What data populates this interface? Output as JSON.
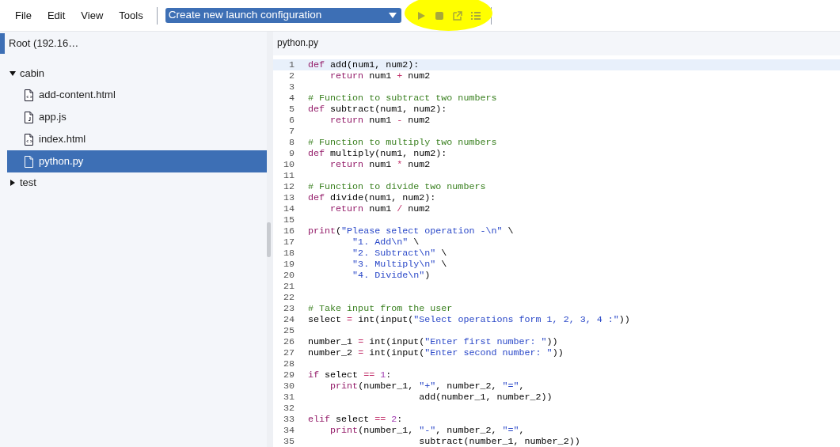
{
  "menu": [
    {
      "label": "File"
    },
    {
      "label": "Edit"
    },
    {
      "label": "View"
    },
    {
      "label": "Tools"
    }
  ],
  "launch_dropdown": {
    "value": "Create new launch configuration"
  },
  "toolbar": {
    "highlighted": true,
    "buttons": [
      {
        "kind": "run",
        "disabled": true
      },
      {
        "kind": "stop",
        "disabled": true
      },
      {
        "kind": "open",
        "disabled": true
      },
      {
        "kind": "list",
        "disabled": true
      }
    ]
  },
  "sidebar": {
    "root": "Root (192.16…",
    "tree": [
      {
        "label": "cabin",
        "expanded": true,
        "selected": false,
        "children": [
          {
            "label": "add-content.html",
            "kind": "html",
            "selected": false
          },
          {
            "label": "app.js",
            "kind": "js",
            "selected": false
          },
          {
            "label": "index.html",
            "kind": "html",
            "selected": false
          },
          {
            "label": "python.py",
            "kind": "file",
            "selected": true
          }
        ]
      },
      {
        "label": "test",
        "expanded": false,
        "selected": false
      }
    ]
  },
  "editor": {
    "tab": "python.py",
    "lines": [
      {
        "number": "1",
        "highlighted": true,
        "tokens": [
          {
            "kind": "keyword",
            "text": "def"
          },
          {
            "kind": "plain",
            "text": " add(num1, num2):"
          }
        ]
      },
      {
        "number": "2",
        "highlighted": false,
        "tokens": [
          {
            "kind": "keyword",
            "text": "    return"
          },
          {
            "kind": "plain",
            "text": " num1 "
          },
          {
            "kind": "operator",
            "text": "+"
          },
          {
            "kind": "plain",
            "text": " num2"
          }
        ]
      },
      {
        "number": "3",
        "highlighted": false
      },
      {
        "number": "4",
        "highlighted": false,
        "tokens": [
          {
            "kind": "comment",
            "text": "# Function to subtract two numbers"
          }
        ]
      },
      {
        "number": "5",
        "highlighted": false,
        "tokens": [
          {
            "kind": "keyword",
            "text": "def"
          },
          {
            "kind": "plain",
            "text": " subtract(num1, num2):"
          }
        ]
      },
      {
        "number": "6",
        "highlighted": false,
        "tokens": [
          {
            "kind": "keyword",
            "text": "    return"
          },
          {
            "kind": "plain",
            "text": " num1 "
          },
          {
            "kind": "operator",
            "text": "-"
          },
          {
            "kind": "plain",
            "text": " num2"
          }
        ]
      },
      {
        "number": "7",
        "highlighted": false
      },
      {
        "number": "8",
        "highlighted": false,
        "tokens": [
          {
            "kind": "comment",
            "text": "# Function to multiply two numbers"
          }
        ]
      },
      {
        "number": "9",
        "highlighted": false,
        "tokens": [
          {
            "kind": "keyword",
            "text": "def"
          },
          {
            "kind": "plain",
            "text": " multiply(num1, num2):"
          }
        ]
      },
      {
        "number": "10",
        "highlighted": false,
        "tokens": [
          {
            "kind": "keyword",
            "text": "    return"
          },
          {
            "kind": "plain",
            "text": " num1 "
          },
          {
            "kind": "operator",
            "text": "*"
          },
          {
            "kind": "plain",
            "text": " num2"
          }
        ]
      },
      {
        "number": "11",
        "highlighted": false
      },
      {
        "number": "12",
        "highlighted": false,
        "tokens": [
          {
            "kind": "comment",
            "text": "# Function to divide two numbers"
          }
        ]
      },
      {
        "number": "13",
        "highlighted": false,
        "tokens": [
          {
            "kind": "keyword",
            "text": "def"
          },
          {
            "kind": "plain",
            "text": " divide(num1, num2):"
          }
        ]
      },
      {
        "number": "14",
        "highlighted": false,
        "tokens": [
          {
            "kind": "keyword",
            "text": "    return"
          },
          {
            "kind": "plain",
            "text": " num1 "
          },
          {
            "kind": "operator",
            "text": "/"
          },
          {
            "kind": "plain",
            "text": " num2"
          }
        ]
      },
      {
        "number": "15",
        "highlighted": false
      },
      {
        "number": "16",
        "highlighted": false,
        "tokens": [
          {
            "kind": "keyword",
            "text": "print"
          },
          {
            "kind": "plain",
            "text": "("
          },
          {
            "kind": "string",
            "text": "\"Please select operation -\\n\""
          },
          {
            "kind": "plain",
            "text": " \\"
          }
        ]
      },
      {
        "number": "17",
        "highlighted": false,
        "tokens": [
          {
            "kind": "string",
            "text": "        \"1. Add\\n\""
          },
          {
            "kind": "plain",
            "text": " \\"
          }
        ]
      },
      {
        "number": "18",
        "highlighted": false,
        "tokens": [
          {
            "kind": "string",
            "text": "        \"2. Subtract\\n\""
          },
          {
            "kind": "plain",
            "text": " \\"
          }
        ]
      },
      {
        "number": "19",
        "highlighted": false,
        "tokens": [
          {
            "kind": "string",
            "text": "        \"3. Multiply\\n\""
          },
          {
            "kind": "plain",
            "text": " \\"
          }
        ]
      },
      {
        "number": "20",
        "highlighted": false,
        "tokens": [
          {
            "kind": "string",
            "text": "        \"4. Divide\\n\""
          },
          {
            "kind": "plain",
            "text": ")"
          }
        ]
      },
      {
        "number": "21",
        "highlighted": false
      },
      {
        "number": "22",
        "highlighted": false
      },
      {
        "number": "23",
        "highlighted": false,
        "tokens": [
          {
            "kind": "comment",
            "text": "# Take input from the user"
          }
        ]
      },
      {
        "number": "24",
        "highlighted": false,
        "tokens": [
          {
            "kind": "plain",
            "text": "select "
          },
          {
            "kind": "operator",
            "text": "="
          },
          {
            "kind": "plain",
            "text": " int(input("
          },
          {
            "kind": "string",
            "text": "\"Select operations form 1, 2, 3, 4 :\""
          },
          {
            "kind": "plain",
            "text": "))"
          }
        ]
      },
      {
        "number": "25",
        "highlighted": false
      },
      {
        "number": "26",
        "highlighted": false,
        "tokens": [
          {
            "kind": "plain",
            "text": "number_1 "
          },
          {
            "kind": "operator",
            "text": "="
          },
          {
            "kind": "plain",
            "text": " int(input("
          },
          {
            "kind": "string",
            "text": "\"Enter first number: \""
          },
          {
            "kind": "plain",
            "text": "))"
          }
        ]
      },
      {
        "number": "27",
        "highlighted": false,
        "tokens": [
          {
            "kind": "plain",
            "text": "number_2 "
          },
          {
            "kind": "operator",
            "text": "="
          },
          {
            "kind": "plain",
            "text": " int(input("
          },
          {
            "kind": "string",
            "text": "\"Enter second number: \""
          },
          {
            "kind": "plain",
            "text": "))"
          }
        ]
      },
      {
        "number": "28",
        "highlighted": false
      },
      {
        "number": "29",
        "highlighted": false,
        "tokens": [
          {
            "kind": "keyword",
            "text": "if"
          },
          {
            "kind": "plain",
            "text": " select "
          },
          {
            "kind": "operator",
            "text": "=="
          },
          {
            "kind": "number",
            "text": " 1"
          },
          {
            "kind": "plain",
            "text": ":"
          }
        ]
      },
      {
        "number": "30",
        "highlighted": false,
        "tokens": [
          {
            "kind": "keyword",
            "text": "    print"
          },
          {
            "kind": "plain",
            "text": "(number_1, "
          },
          {
            "kind": "string",
            "text": "\"+\""
          },
          {
            "kind": "plain",
            "text": ", number_2, "
          },
          {
            "kind": "string",
            "text": "\"=\""
          },
          {
            "kind": "plain",
            "text": ","
          }
        ]
      },
      {
        "number": "31",
        "highlighted": false,
        "tokens": [
          {
            "kind": "plain",
            "text": "                    add(number_1, number_2))"
          }
        ]
      },
      {
        "number": "32",
        "highlighted": false
      },
      {
        "number": "33",
        "highlighted": false,
        "tokens": [
          {
            "kind": "keyword",
            "text": "elif"
          },
          {
            "kind": "plain",
            "text": " select "
          },
          {
            "kind": "operator",
            "text": "=="
          },
          {
            "kind": "number",
            "text": " 2"
          },
          {
            "kind": "plain",
            "text": ":"
          }
        ]
      },
      {
        "number": "34",
        "highlighted": false,
        "tokens": [
          {
            "kind": "keyword",
            "text": "    print"
          },
          {
            "kind": "plain",
            "text": "(number_1, "
          },
          {
            "kind": "string",
            "text": "\"-\""
          },
          {
            "kind": "plain",
            "text": ", number_2, "
          },
          {
            "kind": "string",
            "text": "\"=\""
          },
          {
            "kind": "plain",
            "text": ","
          }
        ]
      },
      {
        "number": "35",
        "highlighted": false,
        "tokens": [
          {
            "kind": "plain",
            "text": "                    subtract(number_1, number_2))"
          }
        ]
      }
    ]
  }
}
